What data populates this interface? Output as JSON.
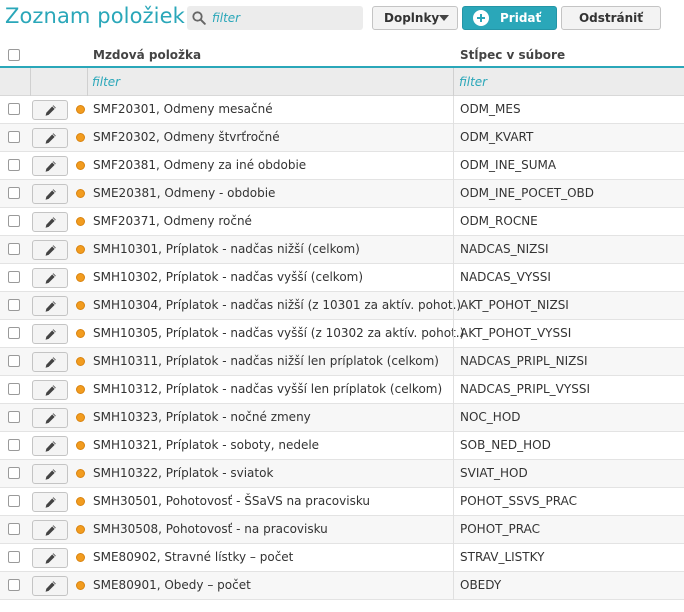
{
  "header": {
    "title": "Zoznam položiek",
    "search_placeholder": "filter",
    "addons_label": "Doplnky",
    "add_label": "Pridať",
    "remove_label": "Odstrániť"
  },
  "colors": {
    "accent": "#2aa7b9",
    "status_dot": "#f29c1f"
  },
  "icons": {
    "search": "search-icon",
    "addons_caret": "caret-down-icon",
    "add": "plus-circle-icon",
    "edit": "pencil-icon",
    "status": "status-dot-icon"
  },
  "table": {
    "columns": {
      "item": "Mzdová položka",
      "column": "Stĺpec v súbore"
    },
    "filter_placeholder_item": "filter",
    "filter_placeholder_column": "filter",
    "rows": [
      {
        "item": "SMF20301, Odmeny mesačné",
        "column": "ODM_MES"
      },
      {
        "item": "SMF20302, Odmeny štvrťročné",
        "column": "ODM_KVART"
      },
      {
        "item": "SMF20381, Odmeny za iné obdobie",
        "column": "ODM_INE_SUMA"
      },
      {
        "item": "SME20381, Odmeny - obdobie",
        "column": "ODM_INE_POCET_OBD"
      },
      {
        "item": "SMF20371, Odmeny ročné",
        "column": "ODM_ROCNE"
      },
      {
        "item": "SMH10301, Príplatok - nadčas nižší (celkom)",
        "column": "NADCAS_NIZSI"
      },
      {
        "item": "SMH10302, Príplatok - nadčas vyšší (celkom)",
        "column": "NADCAS_VYSSI"
      },
      {
        "item": "SMH10304, Príplatok - nadčas nižší (z 10301 za aktív. pohot.)",
        "column": "AKT_POHOT_NIZSI"
      },
      {
        "item": "SMH10305, Príplatok - nadčas vyšší (z 10302 za aktív. pohot.)",
        "column": "AKT_POHOT_VYSSI"
      },
      {
        "item": "SMH10311, Príplatok - nadčas nižší len príplatok (celkom)",
        "column": "NADCAS_PRIPL_NIZSI"
      },
      {
        "item": "SMH10312, Príplatok - nadčas vyšší len príplatok (celkom)",
        "column": "NADCAS_PRIPL_VYSSI"
      },
      {
        "item": "SMH10323, Príplatok - nočné zmeny",
        "column": "NOC_HOD"
      },
      {
        "item": "SMH10321, Príplatok - soboty, nedele",
        "column": "SOB_NED_HOD"
      },
      {
        "item": "SMH10322, Príplatok - sviatok",
        "column": "SVIAT_HOD"
      },
      {
        "item": "SMH30501, Pohotovosť - ŠSaVS na pracovisku",
        "column": "POHOT_SSVS_PRAC"
      },
      {
        "item": "SMH30508, Pohotovosť - na pracovisku",
        "column": "POHOT_PRAC"
      },
      {
        "item": "SME80902, Stravné lístky – počet",
        "column": "STRAV_LISTKY"
      },
      {
        "item": "SME80901, Obedy – počet",
        "column": "OBEDY"
      }
    ]
  }
}
